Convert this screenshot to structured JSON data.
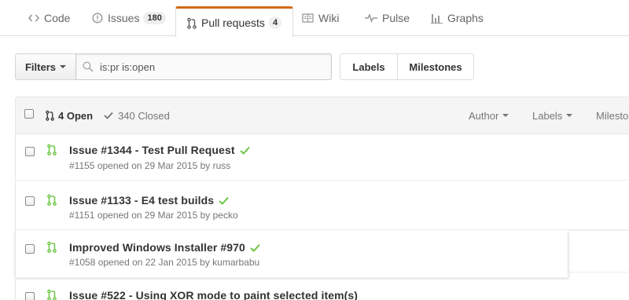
{
  "reponav": {
    "code": "Code",
    "issues": "Issues",
    "issues_count": "180",
    "pull_requests": "Pull requests",
    "pull_requests_count": "4",
    "wiki": "Wiki",
    "pulse": "Pulse",
    "graphs": "Graphs"
  },
  "filter_bar": {
    "filters_label": "Filters",
    "search_value": "is:pr is:open",
    "labels_label": "Labels",
    "milestones_label": "Milestones"
  },
  "table_header": {
    "open_label": "4 Open",
    "closed_label": "340 Closed",
    "author_label": "Author",
    "labels_label": "Labels",
    "milestones_label": "Milesto"
  },
  "pull_requests": [
    {
      "title": "Issue #1344 - Test Pull Request",
      "meta": "#1155 opened on 29 Mar 2015 by russ"
    },
    {
      "title": "Issue #1133 - E4 test builds",
      "meta": "#1151 opened on 29 Mar 2015 by pecko"
    },
    {
      "title": "Improved Windows Installer #970",
      "meta": "#1058 opened on 22 Jan 2015 by kumarbabu"
    },
    {
      "title": "Issue #522 - Using XOR mode to paint selected item(s)",
      "meta": ""
    }
  ],
  "colors": {
    "selected_tab_accent": "#d26911",
    "pr_icon_open": "#6cc644",
    "status_success": "#6cc644"
  }
}
